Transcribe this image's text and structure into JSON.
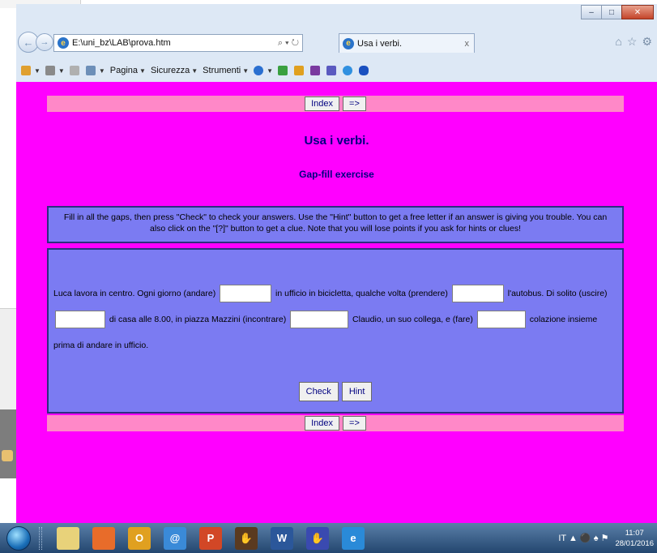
{
  "browser": {
    "address": "E:\\uni_bz\\LAB\\prova.htm",
    "address_tools": "⌕ ▾ ↻",
    "tab_title": "Usa i verbi.",
    "tab_close": "x",
    "window_controls": {
      "minimize": "–",
      "maximize": "□",
      "close": "✕"
    },
    "toolbar_icons": [
      "⌂",
      "☆",
      "⚙"
    ],
    "commands": [
      {
        "label": "",
        "icon": "home-icon",
        "color": "#e0a030"
      },
      {
        "label": "",
        "icon": "rss-feed-icon",
        "color": "#8a8a8a"
      },
      {
        "label": "",
        "icon": "mail-icon",
        "color": "#b0b0b0"
      },
      {
        "label": "",
        "icon": "print-icon",
        "color": "#6d8fb8"
      },
      {
        "label": "Pagina",
        "icon": "",
        "color": ""
      },
      {
        "label": "Sicurezza",
        "icon": "",
        "color": ""
      },
      {
        "label": "Strumenti",
        "icon": "",
        "color": ""
      }
    ],
    "extra_icons": [
      {
        "icon": "help-icon",
        "color": "#2a6fd0"
      },
      {
        "icon": "messenger-icon",
        "color": "#3aa040"
      },
      {
        "icon": "acrobat-icon",
        "color": "#e0a020"
      },
      {
        "icon": "onenote-icon",
        "color": "#7a3aa0"
      },
      {
        "icon": "onenote-icon",
        "color": "#5a5ac0"
      },
      {
        "icon": "skype-icon",
        "color": "#3090e0"
      },
      {
        "icon": "bluetooth-icon",
        "color": "#1a50c0"
      }
    ]
  },
  "page": {
    "nav": {
      "index": "Index",
      "next": "=>"
    },
    "title": "Usa i verbi.",
    "subtitle": "Gap-fill exercise",
    "instructions": "Fill in all the gaps, then press \"Check\" to check your answers. Use the \"Hint\" button to get a free letter if an answer is giving you trouble. You can also click on the \"[?]\" button to get a clue. Note that you will lose points if you ask for hints or clues!",
    "exercise": {
      "segments": [
        "Luca lavora in centro. Ogni giorno (andare)",
        "in ufficio in bicicletta, qualche volta (prendere)",
        "l'autobus. Di solito (uscire)",
        "di casa alle 8.00, in piazza Mazzini (incontrare)",
        "Claudio, un suo collega, e (fare)",
        "colazione insieme prima di andare in ufficio."
      ],
      "gaps": [
        "",
        "",
        "",
        "",
        ""
      ],
      "check_label": "Check",
      "hint_label": "Hint"
    }
  },
  "taskbar": {
    "apps": [
      {
        "icon": "file-explorer-icon",
        "glyph": "",
        "color": "#e8d27a"
      },
      {
        "icon": "file-manager-icon",
        "glyph": "",
        "color": "#e86c2a"
      },
      {
        "icon": "outlook-icon",
        "glyph": "O",
        "color": "#e0a020"
      },
      {
        "icon": "search-app-icon",
        "glyph": "@",
        "color": "#3a8ad8"
      },
      {
        "icon": "powerpoint-icon",
        "glyph": "P",
        "color": "#d24726"
      },
      {
        "icon": "hot-potatoes-icon",
        "glyph": "✋",
        "color": "#5a3a20"
      },
      {
        "icon": "word-icon",
        "glyph": "W",
        "color": "#2b579a"
      },
      {
        "icon": "hot-potatoes-icon",
        "glyph": "✋",
        "color": "#3a4ab0"
      },
      {
        "icon": "internet-explorer-icon",
        "glyph": "e",
        "color": "#2a8ad8"
      }
    ],
    "language": "IT",
    "time": "11:07",
    "date": "28/01/2016"
  }
}
